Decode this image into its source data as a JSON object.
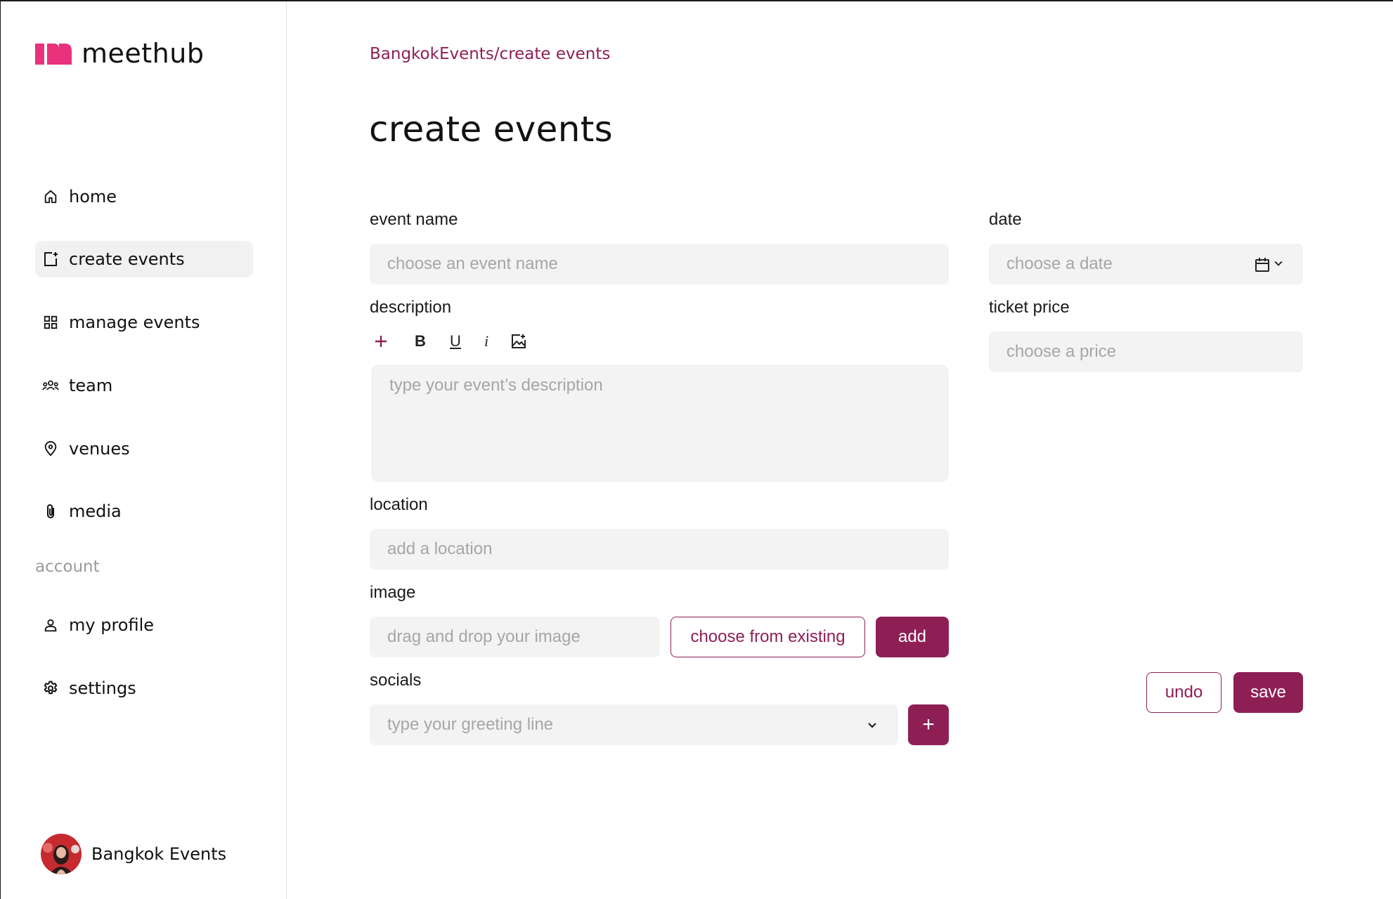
{
  "app": {
    "name": "meethub"
  },
  "sidebar": {
    "items": [
      {
        "label": "home",
        "icon": "home-icon"
      },
      {
        "label": "create events",
        "icon": "calendar-plus-icon",
        "active": true
      },
      {
        "label": "manage events",
        "icon": "grid-icon"
      },
      {
        "label": "team",
        "icon": "team-icon"
      },
      {
        "label": "venues",
        "icon": "map-pin-icon"
      },
      {
        "label": "media",
        "icon": "paperclip-icon"
      }
    ],
    "account_section_label": "account",
    "account_items": [
      {
        "label": "my profile",
        "icon": "user-icon"
      },
      {
        "label": "settings",
        "icon": "gear-icon"
      }
    ],
    "profile": {
      "name": "Bangkok Events"
    }
  },
  "main": {
    "breadcrumb": "BangkokEvents/create events",
    "title": "create events",
    "form": {
      "event_name": {
        "label": "event name",
        "placeholder": "choose an event name"
      },
      "description": {
        "label": "description",
        "placeholder": "type your event’s description",
        "toolbar": [
          "add",
          "bold",
          "underline",
          "italic",
          "image"
        ]
      },
      "location": {
        "label": "location",
        "placeholder": "add a location"
      },
      "image": {
        "label": "image",
        "placeholder": "drag and drop your image",
        "choose_label": "choose from existing",
        "add_label": "add"
      },
      "socials": {
        "label": "socials",
        "placeholder": "type your greeting line",
        "add_symbol": "+"
      },
      "date": {
        "label": "date",
        "placeholder": "choose a date"
      },
      "ticket_price": {
        "label": "ticket price",
        "placeholder": "choose a price"
      }
    },
    "actions": {
      "undo_label": "undo",
      "save_label": "save"
    }
  },
  "colors": {
    "accent": "#8e1f55",
    "brand": "#e8327c",
    "field_bg": "#f3f3f3",
    "placeholder": "#a6a6a6"
  }
}
